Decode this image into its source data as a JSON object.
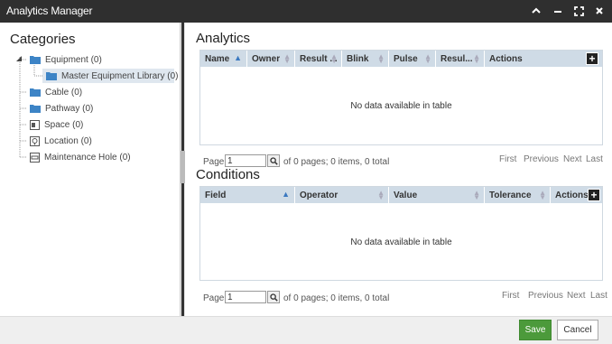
{
  "window": {
    "title": "Analytics Manager",
    "controls": [
      "chevron-up-icon",
      "minimize-icon",
      "maximize-icon",
      "close-icon"
    ]
  },
  "categories": {
    "heading": "Categories",
    "items": [
      {
        "label": "Equipment (0)",
        "icon": "folder-icon"
      },
      {
        "label": "Master Equipment Library (0)",
        "icon": "folder-icon",
        "selected": true
      },
      {
        "label": "Cable (0)",
        "icon": "folder-icon"
      },
      {
        "label": "Pathway (0)",
        "icon": "folder-icon"
      },
      {
        "label": "Space (0)",
        "icon": "space-icon"
      },
      {
        "label": "Location (0)",
        "icon": "location-icon"
      },
      {
        "label": "Maintenance Hole (0)",
        "icon": "maintenance-hole-icon"
      }
    ]
  },
  "analytics": {
    "heading": "Analytics",
    "columns": [
      "Name",
      "Owner",
      "Result ...",
      "Blink",
      "Pulse",
      "Resul...",
      "Actions"
    ],
    "empty_message": "No data available in table",
    "pager": {
      "page_label": "Page",
      "page_value": "1",
      "summary": "of 0 pages; 0 items, 0 total",
      "first": "First",
      "previous": "Previous",
      "next": "Next",
      "last": "Last"
    }
  },
  "conditions": {
    "heading": "Conditions",
    "columns": [
      "Field",
      "Operator",
      "Value",
      "Tolerance",
      "Actions"
    ],
    "empty_message": "No data available in table",
    "pager": {
      "page_label": "Page",
      "page_value": "1",
      "summary": "of 0 pages; 0 items, 0 total",
      "first": "First",
      "previous": "Previous",
      "next": "Next",
      "last": "Last"
    }
  },
  "footer": {
    "save_label": "Save",
    "cancel_label": "Cancel"
  },
  "colors": {
    "titlebar": "#2f2f2f",
    "grid_header": "#cfdbe6",
    "folder": "#3d84c6",
    "save": "#4c9a3b"
  }
}
